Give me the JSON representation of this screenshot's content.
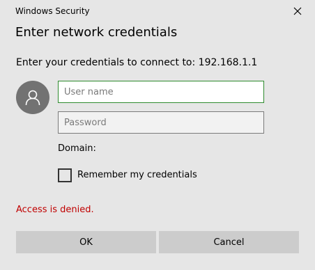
{
  "window": {
    "title": "Windows Security"
  },
  "dialog": {
    "heading": "Enter network credentials",
    "prompt": "Enter your credentials to connect to: 192.168.1.1",
    "username_placeholder": "User name",
    "username_value": "",
    "password_placeholder": "Password",
    "password_value": "",
    "domain_label": "Domain:",
    "remember_label": "Remember my credentials",
    "remember_checked": false,
    "error_text": "Access is denied.",
    "ok_label": "OK",
    "cancel_label": "Cancel"
  },
  "icons": {
    "close": "close-icon",
    "avatar": "user-icon"
  },
  "colors": {
    "background": "#e6e6e6",
    "error": "#c00000",
    "focus_border": "#2e8b2e",
    "avatar_bg": "#727272",
    "button_bg": "#cccccc"
  }
}
